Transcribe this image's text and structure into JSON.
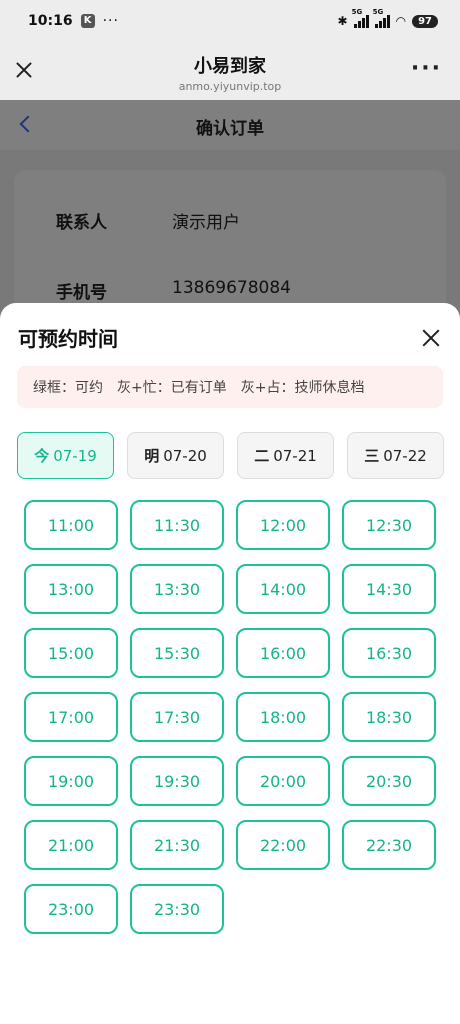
{
  "status_bar": {
    "time": "10:16",
    "app_badge": "K",
    "dots": "···",
    "battery": "97"
  },
  "browser": {
    "title": "小易到家",
    "url": "anmo.yiyunvip.top",
    "more": "···"
  },
  "page": {
    "title": "确认订单",
    "contact_label": "联系人",
    "contact_value": "演示用户",
    "phone_label": "手机号",
    "phone_value": "13869678084"
  },
  "sheet": {
    "title": "可预约时间",
    "legend": [
      "绿框：可约",
      "灰+忙：已有订单",
      "灰+占：技师休息档"
    ],
    "dates": [
      {
        "day": "今",
        "date": "07-19",
        "active": true
      },
      {
        "day": "明",
        "date": "07-20",
        "active": false
      },
      {
        "day": "二",
        "date": "07-21",
        "active": false
      },
      {
        "day": "三",
        "date": "07-22",
        "active": false
      }
    ],
    "slots": [
      "11:00",
      "11:30",
      "12:00",
      "12:30",
      "13:00",
      "13:30",
      "14:00",
      "14:30",
      "15:00",
      "15:30",
      "16:00",
      "16:30",
      "17:00",
      "17:30",
      "18:00",
      "18:30",
      "19:00",
      "19:30",
      "20:00",
      "20:30",
      "21:00",
      "21:30",
      "22:00",
      "22:30",
      "23:00",
      "23:30"
    ]
  },
  "colors": {
    "accent": "#1fc19a",
    "accent_text": "#13b58a",
    "legend_bg": "#fdf0ee"
  }
}
